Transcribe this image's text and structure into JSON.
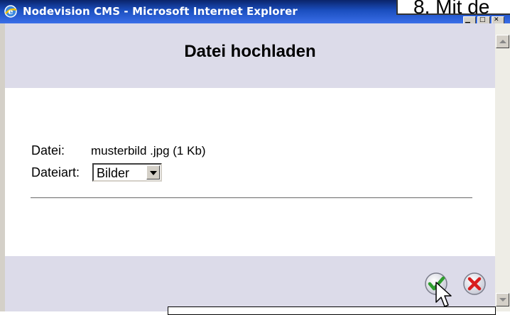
{
  "window": {
    "title": "Nodevision CMS - Microsoft Internet Explorer",
    "icon": "ie-icon",
    "controls": [
      "minimize-icon",
      "maximize-icon",
      "close-icon"
    ]
  },
  "callout": {
    "text": "8. Mit de"
  },
  "dialog": {
    "title": "Datei hochladen",
    "file_label": "Datei:",
    "file_value": "musterbild .jpg (1 Kb)",
    "type_label": "Dateiart:",
    "type_select": {
      "value": "Bilder"
    }
  },
  "footer": {
    "ok_icon": "checkmark-icon",
    "cancel_icon": "cancel-x-icon"
  },
  "colors": {
    "titlebar": "#0a246a",
    "panel": "#dcdbe9",
    "ok_green": "#2e9e2e",
    "cancel_red": "#d81e1e"
  }
}
